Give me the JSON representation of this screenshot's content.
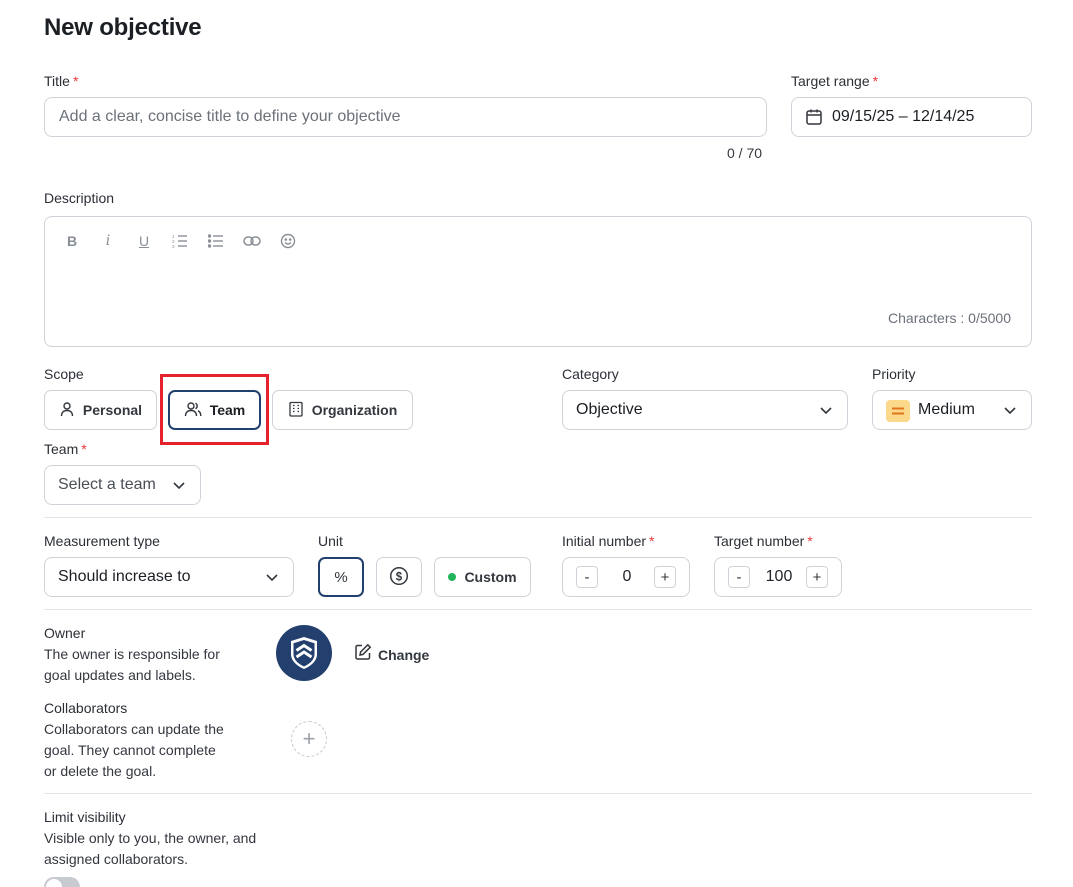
{
  "page": {
    "title": "New objective"
  },
  "title_field": {
    "label": "Title",
    "required_mark": "*",
    "placeholder": "Add a clear, concise title to define your objective",
    "counter": "0 / 70"
  },
  "target_range": {
    "label": "Target range",
    "required_mark": "*",
    "value": "09/15/25 – 12/14/25",
    "icon": "calendar-icon"
  },
  "description": {
    "label": "Description",
    "toolbar": [
      {
        "name": "bold",
        "glyph": "B"
      },
      {
        "name": "italic",
        "glyph": "i"
      },
      {
        "name": "underline",
        "glyph": "U"
      },
      {
        "name": "ordered-list",
        "glyph": ""
      },
      {
        "name": "bullet-list",
        "glyph": ""
      },
      {
        "name": "link",
        "glyph": ""
      },
      {
        "name": "emoji",
        "glyph": ""
      }
    ],
    "char_counter": "Characters : 0/5000"
  },
  "scope": {
    "label": "Scope",
    "options": [
      {
        "label": "Personal",
        "icon": "user-icon",
        "selected": false
      },
      {
        "label": "Team",
        "icon": "users-icon",
        "selected": true
      },
      {
        "label": "Organization",
        "icon": "building-icon",
        "selected": false
      }
    ],
    "highlight_color": "#e5212b"
  },
  "category": {
    "label": "Category",
    "value": "Objective"
  },
  "priority": {
    "label": "Priority",
    "value": "Medium",
    "badge_color": "#fcd98a",
    "icon": "equals-icon"
  },
  "team": {
    "label": "Team",
    "required_mark": "*",
    "placeholder": "Select a team"
  },
  "measurement": {
    "label": "Measurement type",
    "value": "Should increase to"
  },
  "unit": {
    "label": "Unit",
    "options": [
      {
        "label": "%",
        "icon": "percent-icon",
        "selected": true
      },
      {
        "label": "$",
        "icon": "dollar-circle-icon",
        "selected": false
      },
      {
        "label": "Custom",
        "icon": "green-dot-icon",
        "selected": false,
        "dot_color": "#22b45a"
      }
    ]
  },
  "initial_number": {
    "label": "Initial number",
    "required_mark": "*",
    "value": "0",
    "minus": "-",
    "plus": "+"
  },
  "target_number": {
    "label": "Target number",
    "required_mark": "*",
    "value": "100",
    "minus": "-",
    "plus": "+"
  },
  "owner": {
    "label": "Owner",
    "help": [
      "The owner is responsible for",
      "goal updates and labels."
    ],
    "change_label": "Change",
    "avatar_color": "#233f6e"
  },
  "collaborators": {
    "label": "Collaborators",
    "help": [
      "Collaborators can update the",
      "goal. They cannot complete",
      "or delete the goal."
    ],
    "add_glyph": "+"
  },
  "visibility": {
    "label": "Limit visibility",
    "help": [
      "Visible only to you, the owner, and",
      "assigned collaborators."
    ],
    "enabled": false
  },
  "colors": {
    "accent": "#22406e",
    "required": "#e5383b",
    "highlight": "#e5212b"
  }
}
